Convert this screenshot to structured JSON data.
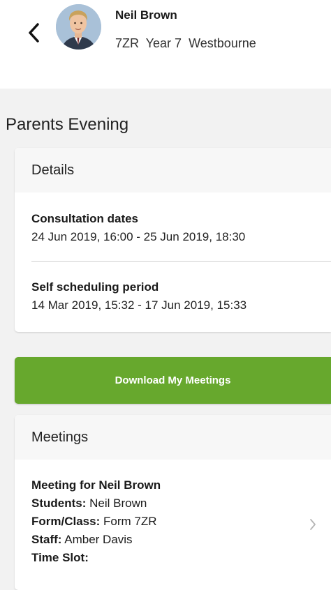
{
  "header": {
    "student_name": "Neil Brown",
    "student_meta": "7ZR  Year 7  Westbourne",
    "back_icon": "chevron-left-icon",
    "avatar": "student-photo"
  },
  "page": {
    "title": "Parents Evening"
  },
  "details": {
    "title": "Details",
    "items": [
      {
        "label": "Consultation dates",
        "value": "24 Jun 2019, 16:00 - 25 Jun 2019, 18:30"
      },
      {
        "label": "Self scheduling period",
        "value": "14 Mar 2019, 15:32 - 17 Jun 2019, 15:33"
      }
    ]
  },
  "download_button": {
    "label": "Download My Meetings",
    "color": "#67a82d"
  },
  "meetings": {
    "title": "Meetings",
    "items": [
      {
        "heading": "Meeting for Neil Brown",
        "students_label": "Students:",
        "students": "Neil Brown",
        "form_label": "Form/Class:",
        "form": "Form 7ZR",
        "staff_label": "Staff:",
        "staff": "Amber Davis",
        "slot_label": "Time Slot:",
        "slot": ""
      }
    ],
    "chevron_icon": "chevron-right-icon"
  }
}
